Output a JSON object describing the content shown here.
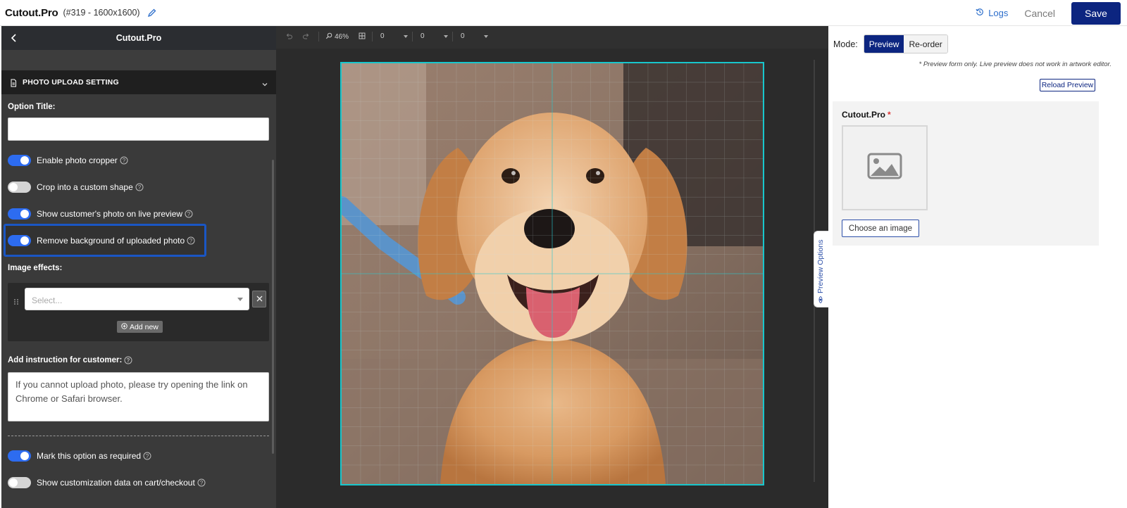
{
  "header": {
    "app_title": "Cutout.Pro",
    "meta": "(#319 - 1600x1600)",
    "logs_label": "Logs",
    "cancel_label": "Cancel",
    "save_label": "Save"
  },
  "left_panel": {
    "title": "Cutout.Pro",
    "section_title": "PHOTO UPLOAD SETTING",
    "option_title_label": "Option Title:",
    "option_title_value": "",
    "toggles": [
      {
        "label": "Enable photo cropper",
        "on": true
      },
      {
        "label": "Crop into a custom shape",
        "on": false
      },
      {
        "label": "Show customer's photo on live preview",
        "on": true
      },
      {
        "label": "Remove background of uploaded photo",
        "on": true
      }
    ],
    "image_effects_label": "Image effects:",
    "select_placeholder": "Select...",
    "add_new_label": "Add new",
    "instruction_label": "Add instruction for customer:",
    "instruction_value": "If you cannot upload photo, please try opening the link on Chrome or Safari browser.",
    "bottom_toggles": [
      {
        "label": "Mark this option as required",
        "on": true
      },
      {
        "label": "Show customization data on cart/checkout",
        "on": false
      }
    ]
  },
  "canvas_toolbar": {
    "zoom": "46%",
    "field1": "0",
    "field2": "0",
    "field3": "0"
  },
  "preview_tab_label": "Preview Options",
  "right_panel": {
    "mode_label": "Mode:",
    "mode_options": [
      "Preview",
      "Re-order"
    ],
    "mode_selected": "Preview",
    "preview_note": "* Preview form only. Live preview does not work in artwork editor.",
    "reload_label": "Reload Preview",
    "form_field_label": "Cutout.Pro",
    "choose_image_label": "Choose an image"
  },
  "colors": {
    "primary": "#0c2580",
    "toggle_on": "#2d6cf0",
    "highlight": "#1a56c4",
    "artboard_border": "#18c6cc",
    "link": "#2c6ecb"
  }
}
